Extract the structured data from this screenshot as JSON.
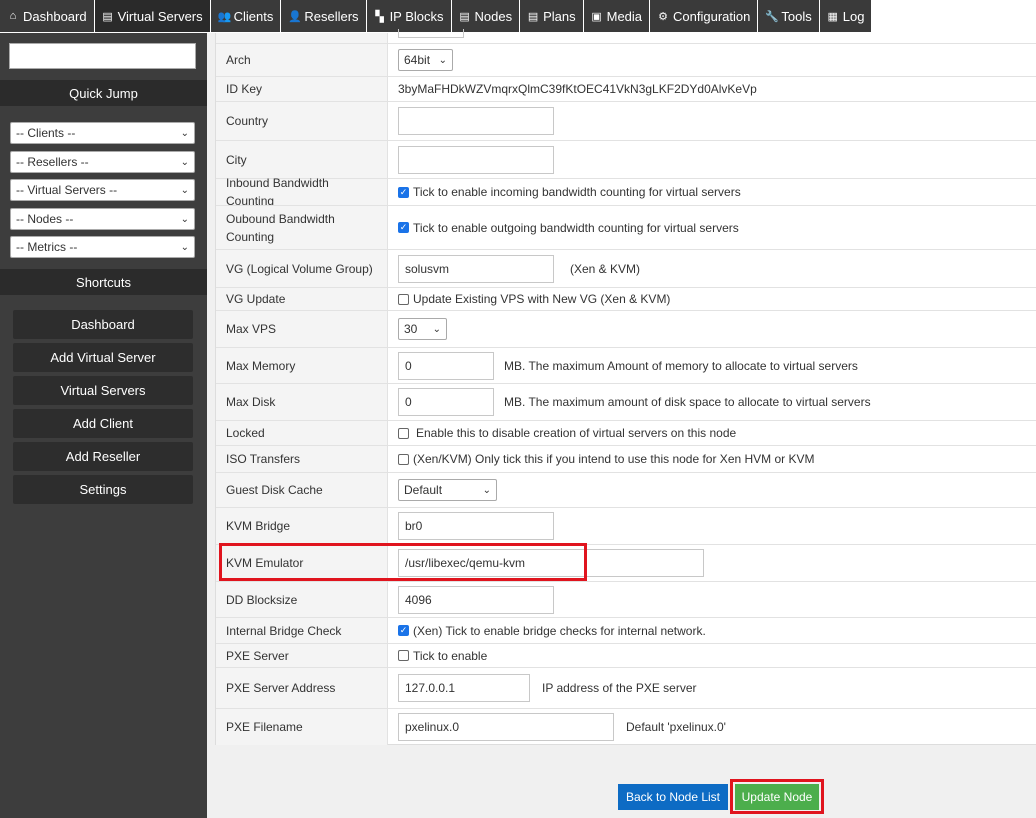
{
  "nav": [
    {
      "icon": "⌂",
      "icon_name": "home-icon",
      "label": "Dashboard"
    },
    {
      "icon": "▤",
      "icon_name": "server-icon",
      "label": "Virtual Servers"
    },
    {
      "icon": "👥",
      "icon_name": "users-icon",
      "label": "Clients"
    },
    {
      "icon": "👤",
      "icon_name": "user-icon",
      "label": "Resellers"
    },
    {
      "icon": "▚",
      "icon_name": "ip-blocks-icon",
      "label": "IP Blocks"
    },
    {
      "icon": "▤",
      "icon_name": "nodes-icon",
      "label": "Nodes"
    },
    {
      "icon": "▤",
      "icon_name": "plans-icon",
      "label": "Plans"
    },
    {
      "icon": "▣",
      "icon_name": "media-icon",
      "label": "Media"
    },
    {
      "icon": "⚙",
      "icon_name": "gear-icon",
      "label": "Configuration"
    },
    {
      "icon": "🔧",
      "icon_name": "wrench-icon",
      "label": "Tools"
    },
    {
      "icon": "▦",
      "icon_name": "log-icon",
      "label": "Log"
    }
  ],
  "sidebar": {
    "quick_jump_title": "Quick Jump",
    "selects": [
      "-- Clients --",
      "-- Resellers --",
      "-- Virtual Servers --",
      "-- Nodes --",
      "-- Metrics --"
    ],
    "shortcuts_title": "Shortcuts",
    "shortcuts": [
      "Dashboard",
      "Add Virtual Server",
      "Virtual Servers",
      "Add Client",
      "Add Reseller",
      "Settings"
    ]
  },
  "form": {
    "arch": {
      "label": "Arch",
      "value": "64bit"
    },
    "id_key": {
      "label": "ID Key",
      "value": "3byMaFHDkWZVmqrxQlmC39fKtOEC41VkN3gLKF2DYd0AlvKeVp"
    },
    "country": {
      "label": "Country",
      "value": ""
    },
    "city": {
      "label": "City",
      "value": ""
    },
    "inbound": {
      "label": "Inbound Bandwidth Counting",
      "text": "Tick to enable incoming bandwidth counting for virtual servers"
    },
    "outbound": {
      "label": "Oubound Bandwidth Counting",
      "text": "Tick to enable outgoing bandwidth counting for virtual servers"
    },
    "vg": {
      "label": "VG (Logical Volume Group)",
      "value": "solusvm",
      "hint": "(Xen & KVM)"
    },
    "vg_update": {
      "label": "VG Update",
      "text": "Update Existing VPS with New VG (Xen & KVM)"
    },
    "max_vps": {
      "label": "Max VPS",
      "value": "30"
    },
    "max_memory": {
      "label": "Max Memory",
      "value": "0",
      "hint": "MB. The maximum Amount of memory to allocate to virtual servers"
    },
    "max_disk": {
      "label": "Max Disk",
      "value": "0",
      "hint": "MB. The maximum amount of disk space to allocate to virtual servers"
    },
    "locked": {
      "label": "Locked",
      "text": "Enable this to disable creation of virtual servers on this node"
    },
    "iso": {
      "label": "ISO Transfers",
      "text": "(Xen/KVM) Only tick this if you intend to use this node for Xen HVM or KVM"
    },
    "guest_cache": {
      "label": "Guest Disk Cache",
      "value": "Default"
    },
    "kvm_bridge": {
      "label": "KVM Bridge",
      "value": "br0"
    },
    "kvm_emulator": {
      "label": "KVM Emulator",
      "value": "/usr/libexec/qemu-kvm"
    },
    "dd_block": {
      "label": "DD Blocksize",
      "value": "4096"
    },
    "bridge_check": {
      "label": "Internal Bridge Check",
      "text": "(Xen) Tick to enable bridge checks for internal network."
    },
    "pxe_server": {
      "label": "PXE Server",
      "text": "Tick to enable"
    },
    "pxe_address": {
      "label": "PXE Server Address",
      "value": "127.0.0.1",
      "hint": "IP address of the PXE server"
    },
    "pxe_filename": {
      "label": "PXE Filename",
      "value": "pxelinux.0",
      "hint": "Default 'pxelinux.0'"
    }
  },
  "buttons": {
    "back": "Back to Node List",
    "update": "Update Node"
  },
  "colors": {
    "highlight": "#e0141e",
    "primary": "#0d6bc4",
    "success": "#4cae4c"
  }
}
